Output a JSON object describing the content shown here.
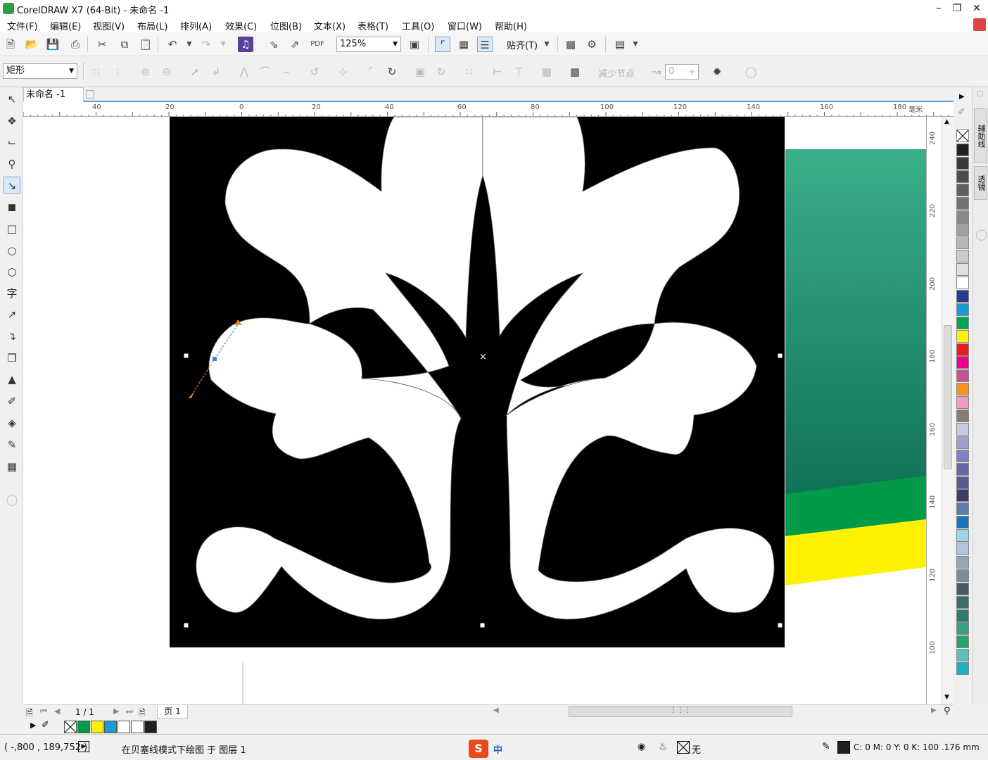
{
  "window": {
    "title": "CorelDRAW X7 (64-Bit) - 未命名 -1"
  },
  "menu": [
    "文件(F)",
    "编辑(E)",
    "视图(V)",
    "布局(L)",
    "排列(A)",
    "效果(C)",
    "位图(B)",
    "文本(X)",
    "表格(T)",
    "工具(O)",
    "窗口(W)",
    "帮助(H)"
  ],
  "toolbar": {
    "zoom": "125%",
    "snap_label": "贴齐(T)"
  },
  "propertybar": {
    "shape_combo": "矩形",
    "reduce_nodes": "减少节点",
    "curve_smoothness": "0"
  },
  "document": {
    "tab": "未命名 -1",
    "page_counter": "1 / 1",
    "page_tab": "页 1"
  },
  "ruler": {
    "unit": "毫米",
    "h_ticks": [
      "40",
      "20",
      "0",
      "20",
      "40",
      "60",
      "80",
      "100",
      "120",
      "140",
      "160",
      "180"
    ],
    "v_ticks": [
      "240",
      "220",
      "200",
      "180",
      "160",
      "140",
      "120",
      "100"
    ]
  },
  "dockers": {
    "guidelines": "辅助线",
    "lens": "透镜"
  },
  "status": {
    "coords": "( -,800 , 189,752 )",
    "message": "在贝塞线模式下绘图 于 图层 1",
    "ime": "中",
    "fill_none": "无",
    "color_info": "C: 0 M: 0 Y: 0 K: 100 .176 mm"
  },
  "colors": {
    "accent": "#5ba0e0",
    "palette": [
      "#231f20",
      "#3a3a3a",
      "#4d4d4d",
      "#606060",
      "#737373",
      "#8a8a8a",
      "#a0a0a0",
      "#b5b5b5",
      "#cacaca",
      "#e0e0e0",
      "#ffffff",
      "#2b3990",
      "#1c9ad6",
      "#00a651",
      "#fff200",
      "#ed1c24",
      "#ec008c",
      "#c5539a",
      "#f7941d",
      "#f49ac1",
      "#8c7b70",
      "#c8c8e6",
      "#9e9ed2",
      "#7f7fc2",
      "#6868a8",
      "#5a5a90",
      "#3d3d6b",
      "#5b7fb0",
      "#1b75bb",
      "#9dd4ef",
      "#b0c4de",
      "#93a7b9",
      "#7a8c99",
      "#4c5a63",
      "#3e6b6b",
      "#2e7d6e",
      "#3aa17e",
      "#27a56a",
      "#5abfbf",
      "#1bb3c4"
    ],
    "doc_palette": [
      "#009b48",
      "#fff200",
      "#1c9ad6",
      "#ffffff",
      "#ffffff",
      "#231f20"
    ]
  }
}
